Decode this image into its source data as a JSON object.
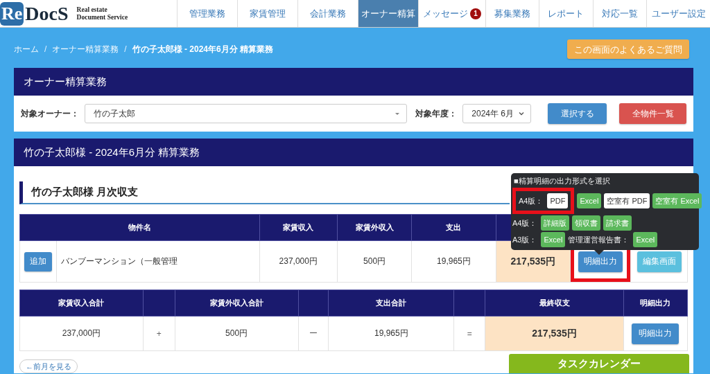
{
  "header": {
    "logo": {
      "mark": "Re",
      "name": "DocS",
      "tagline": [
        "Real estate",
        "Document Service"
      ]
    },
    "nav": [
      {
        "label": "管理業務",
        "selected": false
      },
      {
        "label": "家賃管理",
        "selected": false
      },
      {
        "label": "会計業務",
        "selected": false
      },
      {
        "label": "オーナー精算",
        "selected": true
      },
      {
        "label": "メッセージ",
        "selected": false,
        "badge": "1"
      },
      {
        "label": "募集業務",
        "selected": false
      },
      {
        "label": "レポート",
        "selected": false
      },
      {
        "label": "対応一覧",
        "selected": false
      },
      {
        "label": "ユーザー設定",
        "selected": false
      }
    ]
  },
  "breadcrumb": [
    {
      "label": "ホーム",
      "current": false
    },
    {
      "separator": "/",
      "label": "オーナー精算業務",
      "current": false
    },
    {
      "separator": "/",
      "label": "竹の子太郎様 - 2024年6月分 精算業務",
      "current": true
    }
  ],
  "faq_button": "この画面のよくあるご質問",
  "owner_panel": {
    "title": "オーナー精算業務",
    "owner_label": "対象オーナー：",
    "owner_value": "竹の子太郎",
    "year_label": "対象年度：",
    "year_value": "2024年 6月",
    "buttons": [
      {
        "label": "選択する",
        "kind": "primary"
      },
      {
        "label": "全物件一覧",
        "kind": "danger"
      }
    ]
  },
  "settlement_panel": {
    "title": "竹の子太郎様 - 2024年6月分 精算業務",
    "section_title": "竹の子太郎様 月次収支",
    "property_table": {
      "columns": [
        {
          "label": "物件名"
        },
        {
          "label": "家賃収入"
        },
        {
          "label": "家賃外収入"
        },
        {
          "label": "支出"
        }
      ],
      "rows": [
        {
          "add": "追加",
          "name": "バンブーマンション（一般管理",
          "rent": "237,000円",
          "other": "500円",
          "expense": "19,965円",
          "balance": "217,535円",
          "actions": [
            {
              "label": "明細出力",
              "kind": "primary",
              "highlighted": true
            },
            {
              "label": "編集画面",
              "kind": "info",
              "highlighted": false
            }
          ]
        }
      ]
    },
    "summary_table": {
      "columns": [
        {
          "kind": "heading",
          "label": "家賃収入合計"
        },
        {
          "kind": "blank"
        },
        {
          "kind": "heading",
          "label": "家賃外収入合計"
        },
        {
          "kind": "blank"
        },
        {
          "kind": "heading",
          "label": "支出合計"
        },
        {
          "kind": "blank"
        },
        {
          "kind": "heading",
          "label": "最終収支"
        },
        {
          "kind": "heading",
          "label": "明細出力"
        }
      ],
      "cells": [
        {
          "kind": "value",
          "text": "237,000円"
        },
        {
          "kind": "operator",
          "text": "+"
        },
        {
          "kind": "value",
          "text": "500円"
        },
        {
          "kind": "operator",
          "text": "ー"
        },
        {
          "kind": "value",
          "text": "19,965円"
        },
        {
          "kind": "operator",
          "text": "="
        },
        {
          "kind": "total",
          "text": "217,535円"
        },
        {
          "kind": "button",
          "text": "明細出力"
        }
      ]
    },
    "prev_button": "←前月を見る"
  },
  "task_calendar": "タスクカレンダー",
  "output_popover": {
    "title": "■精算明細の出力形式を選択",
    "rows": [
      {
        "items": [
          {
            "kind": "frame",
            "highlighted": true,
            "items": [
              {
                "kind": "label",
                "text": "A4版："
              },
              {
                "kind": "button",
                "text": "PDF",
                "color": "#ffffff"
              }
            ]
          },
          {
            "kind": "button",
            "text": "Excel",
            "color": "#5cb85c"
          },
          {
            "kind": "button",
            "text": "空室有 PDF",
            "color": "#ffffff"
          },
          {
            "kind": "button",
            "text": "空室有 Excel",
            "color": "#5cb85c"
          }
        ]
      },
      {
        "items": [
          {
            "kind": "label",
            "text": "A4版："
          },
          {
            "kind": "button",
            "text": "詳細版",
            "color": "#5cb85c"
          },
          {
            "kind": "button",
            "text": "領収書",
            "color": "#5cb85c"
          },
          {
            "kind": "button",
            "text": "請求書",
            "color": "#5cb85c"
          }
        ]
      },
      {
        "items": [
          {
            "kind": "label",
            "text": "A3版："
          },
          {
            "kind": "button",
            "text": "Excel",
            "color": "#5cb85c"
          },
          {
            "kind": "label",
            "text": "管理運営報告書："
          },
          {
            "kind": "button",
            "text": "Excel",
            "color": "#5cb85c"
          }
        ]
      }
    ]
  }
}
